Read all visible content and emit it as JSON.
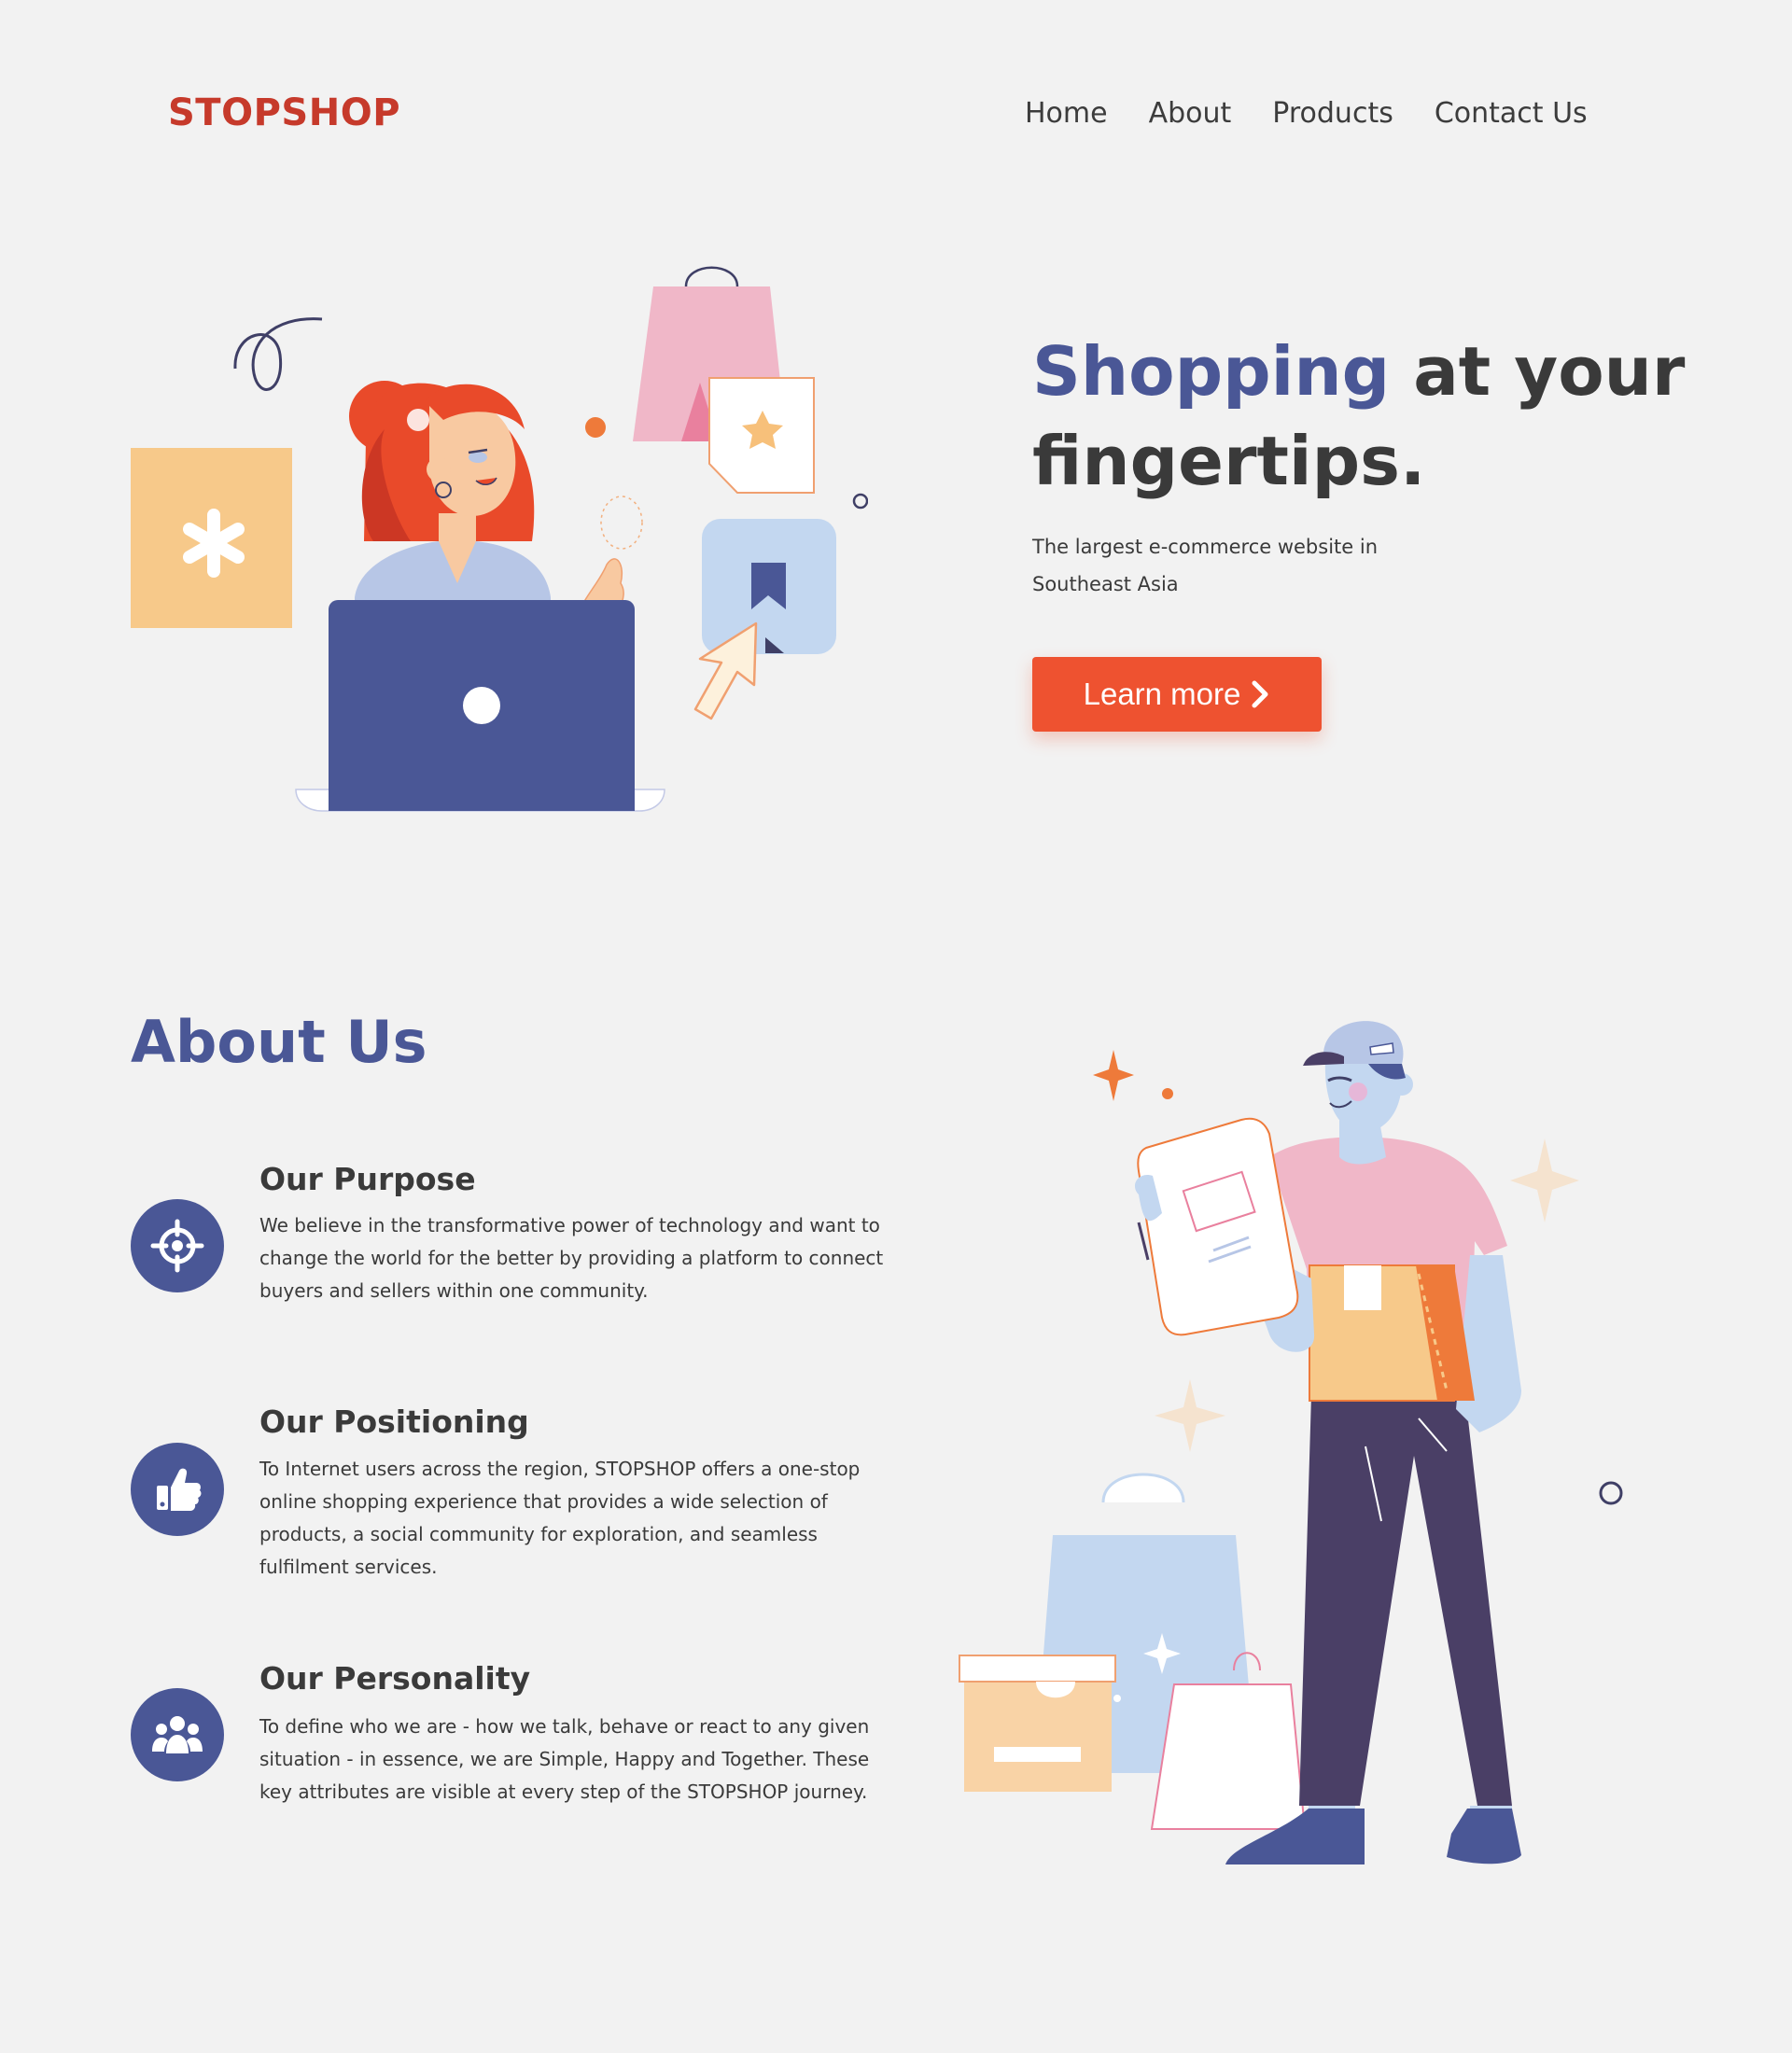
{
  "brand": {
    "logo": "STOPSHOP",
    "logo_color": "#c63a2b"
  },
  "nav": {
    "items": [
      {
        "label": "Home"
      },
      {
        "label": "About"
      },
      {
        "label": "Products"
      },
      {
        "label": "Contact Us"
      }
    ]
  },
  "hero": {
    "title_accent": "Shopping",
    "title_rest_line1": " at your",
    "title_line2": "fingertips.",
    "subtitle": "The largest e-commerce website in Southeast Asia",
    "cta_label": "Learn more",
    "cta_icon": "chevron-right-icon",
    "cta_color": "#ee5230",
    "accent_color": "#4a5796"
  },
  "about": {
    "title": "About Us",
    "features": [
      {
        "icon": "target-icon",
        "title": "Our Purpose",
        "text": "We believe in the transformative power of technology and want to change the world for the better by providing a platform to connect buyers and sellers within one community."
      },
      {
        "icon": "thumbs-up-icon",
        "title": "Our Positioning",
        "text": "To Internet users across the region, STOPSHOP offers a one-stop online shopping experience that provides a wide selection of products, a social community for exploration, and seamless fulfilment services."
      },
      {
        "icon": "people-group-icon",
        "title": "Our Personality",
        "text": "To define who we are - how we talk, behave or react to any given situation - in essence, we are Simple, Happy and Together. These key attributes are visible at every step of the STOPSHOP journey."
      }
    ]
  }
}
